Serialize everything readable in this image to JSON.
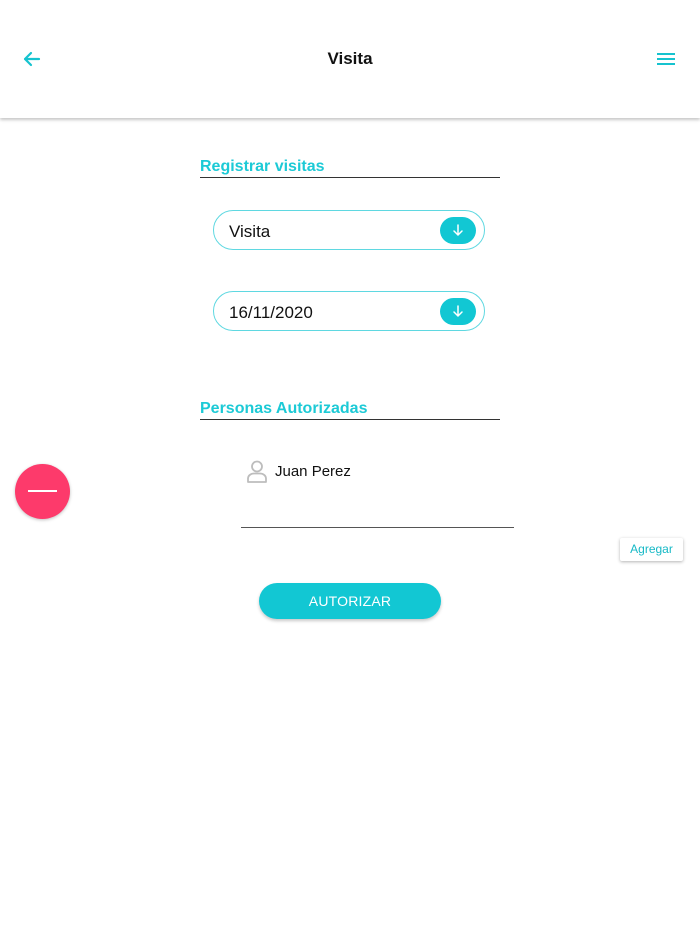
{
  "header": {
    "title": "Visita",
    "back_icon": "arrow-left-icon",
    "menu_icon": "hamburger-menu-icon"
  },
  "register": {
    "section_title": "Registrar visitas",
    "type_select": {
      "value": "Visita",
      "icon": "arrow-down-icon"
    },
    "date_select": {
      "value": "16/11/2020",
      "icon": "arrow-down-icon"
    }
  },
  "authorized": {
    "section_title": "Personas Autorizadas",
    "persons": [
      {
        "name": "Juan Perez",
        "icon": "person-icon"
      }
    ],
    "add_label": "Agregar",
    "remove_icon": "minus-icon"
  },
  "actions": {
    "authorize_label": "AUTORIZAR"
  },
  "colors": {
    "accent": "#12c7d3",
    "fab": "#fd3a6b",
    "text": "#111111"
  }
}
